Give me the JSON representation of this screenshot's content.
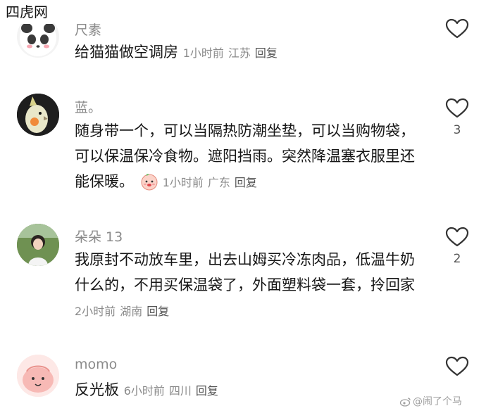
{
  "site_badge": "四虎网",
  "comments": [
    {
      "username": "尺素",
      "text": "给猫猫做空调房",
      "time": "1小时前",
      "location": "江苏",
      "reply": "回复",
      "likes": "",
      "avatar": "panda-avatar-icon"
    },
    {
      "username": "蓝。",
      "text": "随身带一个，可以当隔热防潮坐垫，可以当购物袋，可以保温保冷食物。遮阳挡雨。突然降温塞衣服里还能保暖。",
      "time": "1小时前",
      "location": "广东",
      "reply": "回复",
      "likes": "3",
      "avatar": "bird-avatar-icon",
      "emoji": "peach-face-emoji-icon"
    },
    {
      "username": "朵朵 13",
      "text": "我原封不动放车里，出去山姆买冷冻肉品，低温牛奶什么的，不用买保温袋了，外面塑料袋一套，拎回家",
      "time": "2小时前",
      "location": "湖南",
      "reply": "回复",
      "likes": "2",
      "avatar": "girl-photo-avatar-icon"
    },
    {
      "username": "momo",
      "text": "反光板",
      "time": "6小时前",
      "location": "四川",
      "reply": "回复",
      "likes": "",
      "avatar": "pink-creature-avatar-icon"
    }
  ],
  "watermark": "@闹了个马",
  "colors": {
    "meta": "#8a8a8a",
    "text": "#161616",
    "heart": "#333333"
  }
}
